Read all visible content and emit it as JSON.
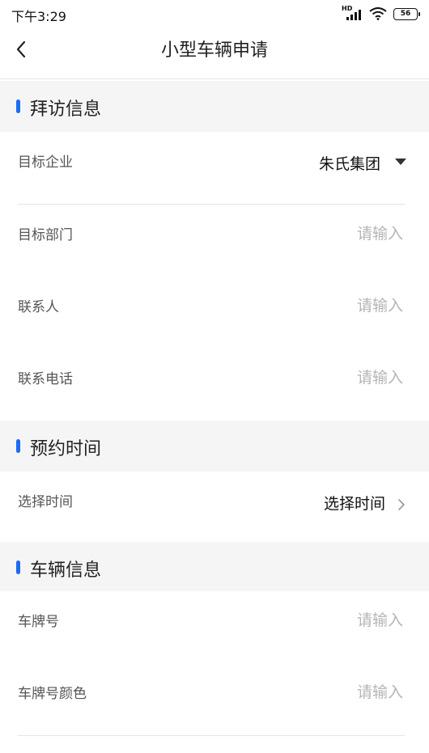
{
  "status_bar": {
    "time": "下午3:29",
    "signal_label": "HD",
    "battery": "56"
  },
  "nav": {
    "title": "小型车辆申请"
  },
  "sections": {
    "visit": {
      "title": "拜访信息",
      "fields": [
        {
          "label": "目标企业",
          "value": "朱氏集团"
        },
        {
          "label": "目标部门",
          "placeholder": "请输入"
        },
        {
          "label": "联系人",
          "placeholder": "请输入"
        },
        {
          "label": "联系电话",
          "placeholder": "请输入"
        }
      ]
    },
    "appointment": {
      "title": "预约时间",
      "fields": [
        {
          "label": "选择时间",
          "value": "选择时间"
        }
      ]
    },
    "vehicle": {
      "title": "车辆信息",
      "fields": [
        {
          "label": "车牌号",
          "placeholder": "请输入"
        },
        {
          "label": "车牌号颜色",
          "placeholder": "请输入"
        }
      ]
    }
  }
}
